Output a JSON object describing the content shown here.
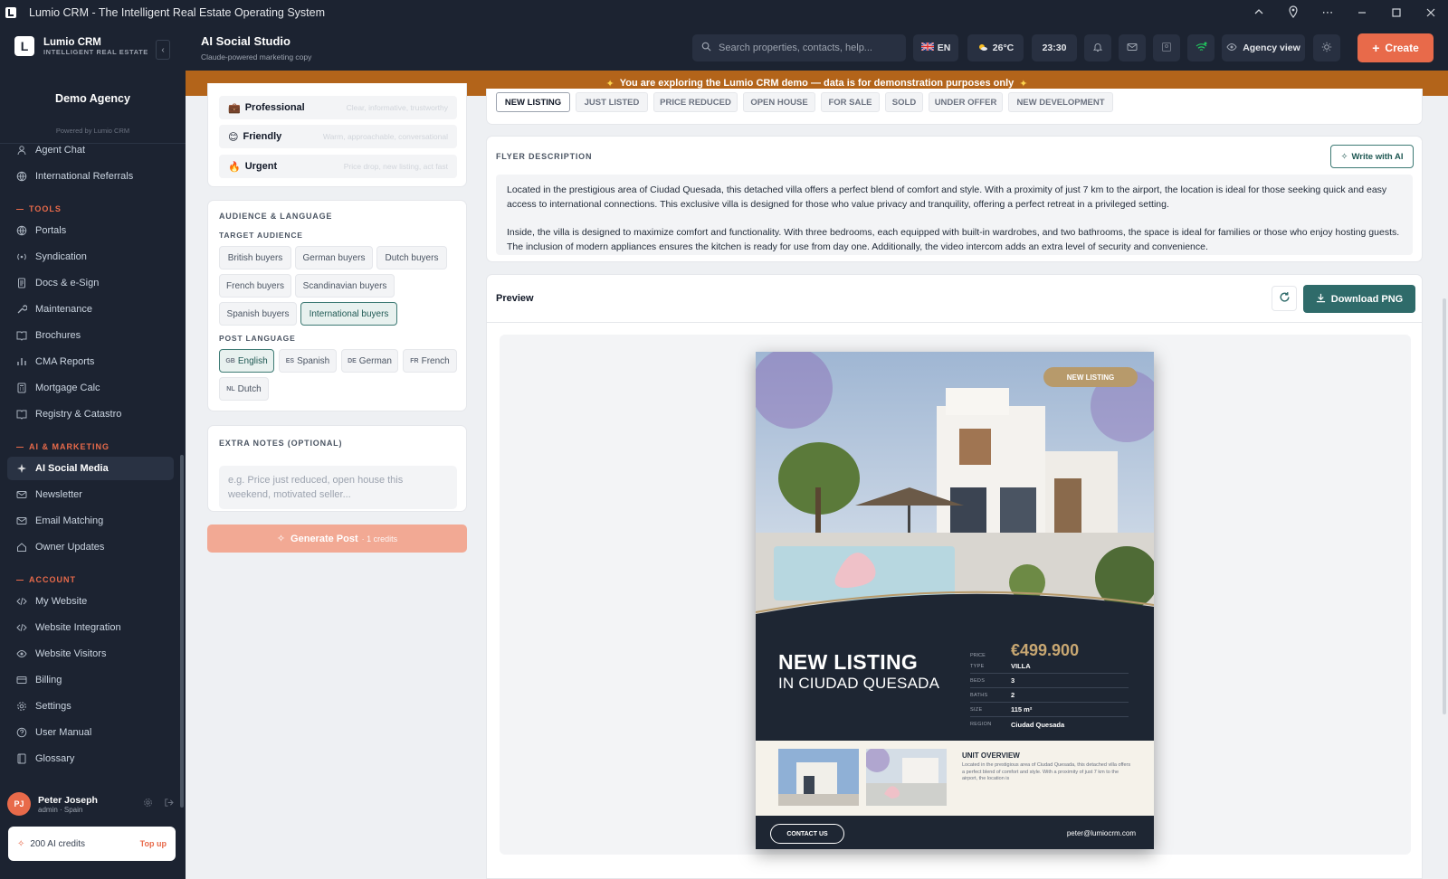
{
  "window": {
    "title": "Lumio CRM - The Intelligent Real Estate Operating System"
  },
  "sidebar": {
    "brand": {
      "name": "Lumio CRM",
      "tagline": "INTELLIGENT REAL ESTATE",
      "mark": "L"
    },
    "agency": "Demo Agency",
    "powered_by": "Powered by Lumio CRM",
    "items_top": [
      {
        "label": "Agent Chat",
        "icon": "people-icon"
      },
      {
        "label": "International Referrals",
        "icon": "globe-icon"
      }
    ],
    "sections": [
      {
        "title": "TOOLS",
        "items": [
          {
            "label": "Portals",
            "icon": "globe-icon"
          },
          {
            "label": "Syndication",
            "icon": "broadcast-icon"
          },
          {
            "label": "Docs & e-Sign",
            "icon": "document-icon"
          },
          {
            "label": "Maintenance",
            "icon": "wrench-icon"
          },
          {
            "label": "Brochures",
            "icon": "book-icon"
          },
          {
            "label": "CMA Reports",
            "icon": "chart-icon"
          },
          {
            "label": "Mortgage Calc",
            "icon": "calculator-icon"
          },
          {
            "label": "Registry & Catastro",
            "icon": "book-icon"
          }
        ]
      },
      {
        "title": "AI & MARKETING",
        "items": [
          {
            "label": "AI Social Media",
            "icon": "sparkle-icon",
            "active": true
          },
          {
            "label": "Newsletter",
            "icon": "mail-icon"
          },
          {
            "label": "Email Matching",
            "icon": "mail-icon"
          },
          {
            "label": "Owner Updates",
            "icon": "home-icon"
          }
        ]
      },
      {
        "title": "ACCOUNT",
        "items": [
          {
            "label": "My Website",
            "icon": "code-icon"
          },
          {
            "label": "Website Integration",
            "icon": "code-icon"
          },
          {
            "label": "Website Visitors",
            "icon": "eye-icon"
          },
          {
            "label": "Billing",
            "icon": "card-icon"
          },
          {
            "label": "Settings",
            "icon": "gear-icon"
          },
          {
            "label": "User Manual",
            "icon": "help-icon"
          },
          {
            "label": "Glossary",
            "icon": "book-icon"
          }
        ]
      }
    ],
    "user": {
      "initials": "PJ",
      "name": "Peter Joseph",
      "role": "admin · Spain"
    },
    "credits": {
      "label": "200 AI credits",
      "topup": "Top up"
    }
  },
  "header": {
    "title": "AI Social Studio",
    "subtitle": "Claude-powered marketing copy",
    "search_placeholder": "Search properties, contacts, help...",
    "language": "EN",
    "weather": "26°C",
    "time": "23:30",
    "agency_view": "Agency view",
    "create": "Create"
  },
  "banner": {
    "text": "You are exploring the Lumio CRM demo — data is for demonstration purposes only"
  },
  "tone": {
    "items": [
      {
        "emoji": "💼",
        "label": "Professional",
        "desc": "Clear, informative, trustworthy"
      },
      {
        "emoji": "😊",
        "label": "Friendly",
        "desc": "Warm, approachable, conversational"
      },
      {
        "emoji": "🔥",
        "label": "Urgent",
        "desc": "Price drop, new listing, act fast"
      }
    ]
  },
  "audience": {
    "title": "AUDIENCE & LANGUAGE",
    "target_label": "TARGET AUDIENCE",
    "targets": [
      "British buyers",
      "German buyers",
      "Dutch buyers",
      "French buyers",
      "Scandinavian buyers",
      "Spanish buyers",
      "International buyers"
    ],
    "selected_target": "International buyers",
    "lang_label": "POST LANGUAGE",
    "languages": [
      {
        "code": "GB",
        "label": "English"
      },
      {
        "code": "ES",
        "label": "Spanish"
      },
      {
        "code": "DE",
        "label": "German"
      },
      {
        "code": "FR",
        "label": "French"
      },
      {
        "code": "NL",
        "label": "Dutch"
      }
    ],
    "selected_language": "English"
  },
  "notes": {
    "title": "EXTRA NOTES (OPTIONAL)",
    "placeholder": "e.g. Price just reduced, open house this weekend, motivated seller..."
  },
  "generate": {
    "label": "Generate Post",
    "credits": "· 1 credits"
  },
  "post_types": [
    "NEW LISTING",
    "JUST LISTED",
    "PRICE REDUCED",
    "OPEN HOUSE",
    "FOR SALE",
    "SOLD",
    "UNDER OFFER",
    "NEW DEVELOPMENT"
  ],
  "active_post_type": "NEW LISTING",
  "flyer_description": {
    "title": "FLYER DESCRIPTION",
    "write_ai": "Write with AI",
    "p1": "Located in the prestigious area of Ciudad Quesada, this detached villa offers a perfect blend of comfort and style. With a proximity of just 7 km to the airport, the location is ideal for those seeking quick and easy access to international connections. This exclusive villa is designed for those who value privacy and tranquility, offering a perfect retreat in a privileged setting.",
    "p2": "Inside, the villa is designed to maximize comfort and functionality. With three bedrooms, each equipped with built-in wardrobes, and two bathrooms, the space is ideal for families or those who enjoy hosting guests. The inclusion of modern appliances ensures the kitchen is ready for use from day one. Additionally, the video intercom adds an extra level of security and convenience."
  },
  "preview": {
    "title": "Preview",
    "download": "Download PNG",
    "flyer": {
      "badge": "NEW LISTING",
      "headline": "NEW LISTING",
      "location": "IN CIUDAD QUESADA",
      "price_label": "PRICE",
      "price": "€499.900",
      "specs": [
        {
          "k": "TYPE",
          "v": "VILLA"
        },
        {
          "k": "BEDS",
          "v": "3"
        },
        {
          "k": "BATHS",
          "v": "2"
        },
        {
          "k": "SIZE",
          "v": "115 m²"
        },
        {
          "k": "REGION",
          "v": "Ciudad Quesada"
        }
      ],
      "unit_title": "UNIT OVERVIEW",
      "unit_text": "Located in the prestigious area of Ciudad Quesada, this detached villa offers a perfect blend of comfort and style. With a proximity of just 7 km to the airport, the location is",
      "contact": "CONTACT US",
      "email": "peter@lumiocrm.com"
    }
  },
  "colors": {
    "accent": "#e86a4a",
    "teal": "#2f6b6a",
    "sidebar": "#1c2331",
    "banner": "#b3641a",
    "gold": "#c8a772"
  }
}
